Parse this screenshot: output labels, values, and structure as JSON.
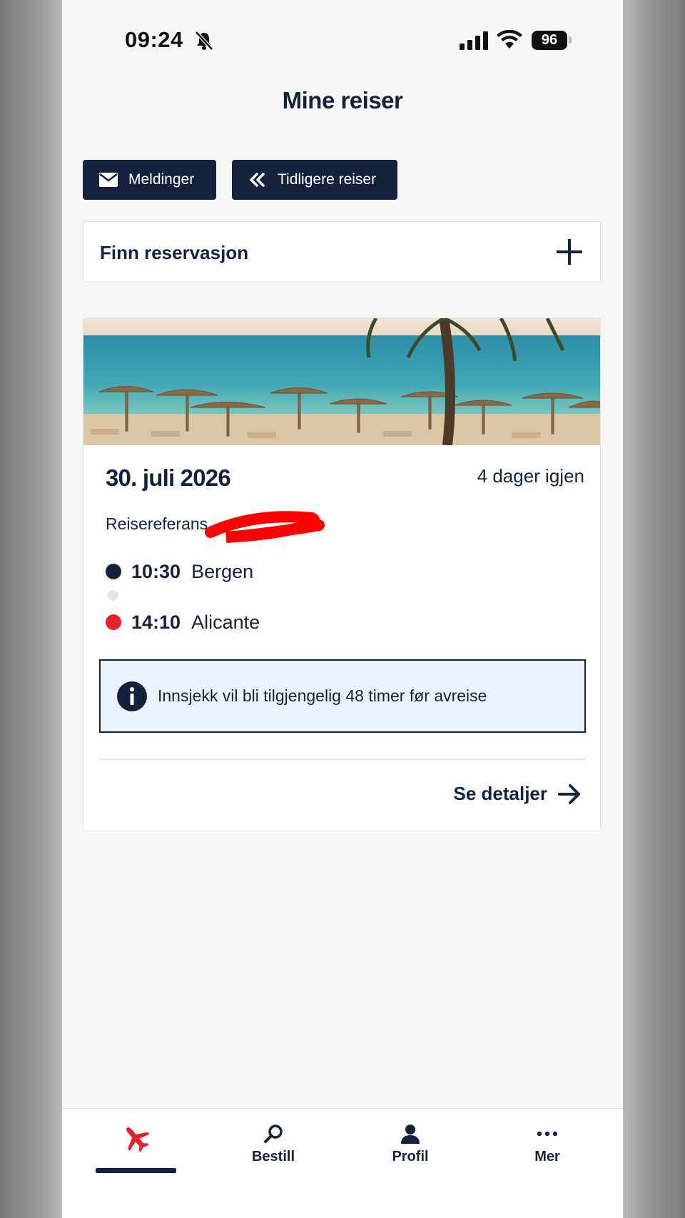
{
  "status_bar": {
    "time": "09:24",
    "battery": "96"
  },
  "header": {
    "title": "Mine reiser"
  },
  "actions": {
    "messages_label": "Meldinger",
    "previous_trips_label": "Tidligere reiser"
  },
  "find_reservation": {
    "label": "Finn reservasjon"
  },
  "trip": {
    "date": "30. juli 2026",
    "countdown": "4 dager igjen",
    "reference_label": "Reisereferans",
    "departure": {
      "time": "10:30",
      "city": "Bergen"
    },
    "arrival": {
      "time": "14:10",
      "city": "Alicante"
    },
    "info_text": "Innsjekk vil bli tilgjengelig 48 timer før avreise",
    "details_label": "Se detaljer"
  },
  "tabbar": {
    "items": [
      {
        "label": "",
        "icon": "plane-icon",
        "active": true
      },
      {
        "label": "Bestill",
        "icon": "search-icon"
      },
      {
        "label": "Profil",
        "icon": "person-icon"
      },
      {
        "label": "Mer",
        "icon": "more-icon"
      }
    ]
  },
  "colors": {
    "navy": "#14223d",
    "red": "#e0232f",
    "info_bg": "#e9f3fe"
  }
}
